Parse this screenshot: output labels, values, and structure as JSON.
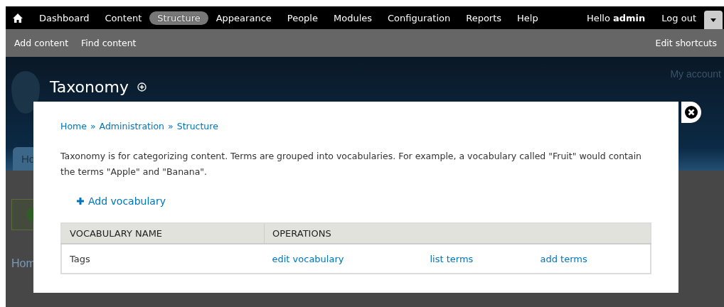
{
  "toolbar": {
    "menu": [
      {
        "label": "Dashboard",
        "selected": false
      },
      {
        "label": "Content",
        "selected": false
      },
      {
        "label": "Structure",
        "selected": true
      },
      {
        "label": "Appearance",
        "selected": false
      },
      {
        "label": "People",
        "selected": false
      },
      {
        "label": "Modules",
        "selected": false
      },
      {
        "label": "Configuration",
        "selected": false
      },
      {
        "label": "Reports",
        "selected": false
      },
      {
        "label": "Help",
        "selected": false
      }
    ],
    "greeting": "Hello",
    "username": "admin",
    "logout": "Log out"
  },
  "shortcuts": {
    "items": [
      "Add content",
      "Find content"
    ],
    "edit": "Edit shortcuts"
  },
  "background": {
    "my_account": "My account",
    "tab": "Ho",
    "breadcrumb": "Hom"
  },
  "overlay": {
    "title": "Taxonomy",
    "breadcrumb": [
      "Home",
      "Administration",
      "Structure"
    ],
    "separator": "»",
    "description": "Taxonomy is for categorizing content. Terms are grouped into vocabularies. For example, a vocabulary called \"Fruit\" would contain the terms \"Apple\" and \"Banana\".",
    "add_link": "Add vocabulary",
    "table": {
      "columns": [
        "VOCABULARY NAME",
        "OPERATIONS"
      ],
      "rows": [
        {
          "name": "Tags",
          "operations": [
            "edit vocabulary",
            "list terms",
            "add terms"
          ]
        }
      ]
    }
  }
}
